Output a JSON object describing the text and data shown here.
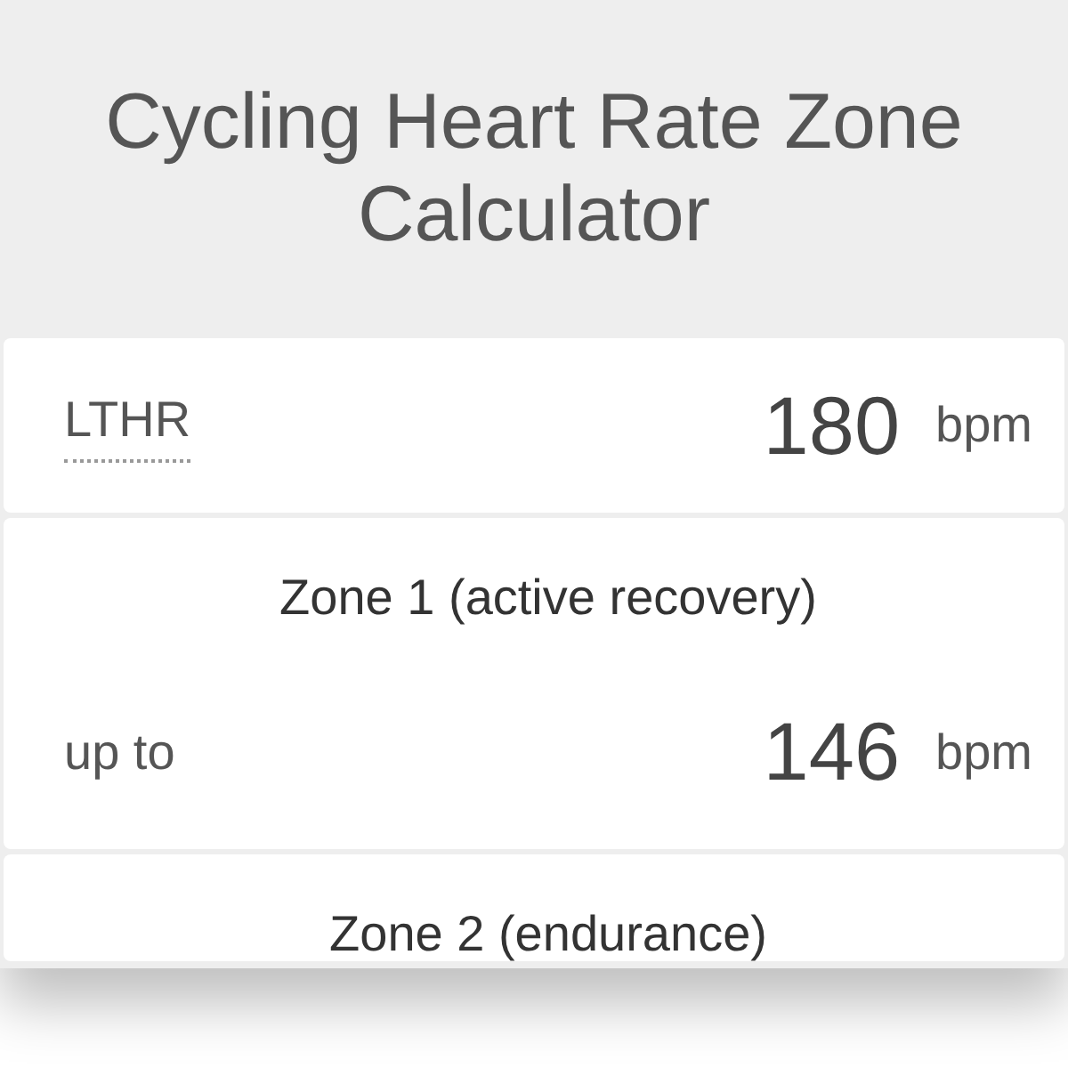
{
  "title": "Cycling Heart Rate Zone Calculator",
  "input": {
    "label": "LTHR",
    "value": "180",
    "unit": "bpm"
  },
  "zones": [
    {
      "name": "Zone 1 (active recovery)",
      "prefix": "up to",
      "value": "146",
      "unit": "bpm"
    },
    {
      "name": "Zone 2 (endurance)"
    }
  ]
}
